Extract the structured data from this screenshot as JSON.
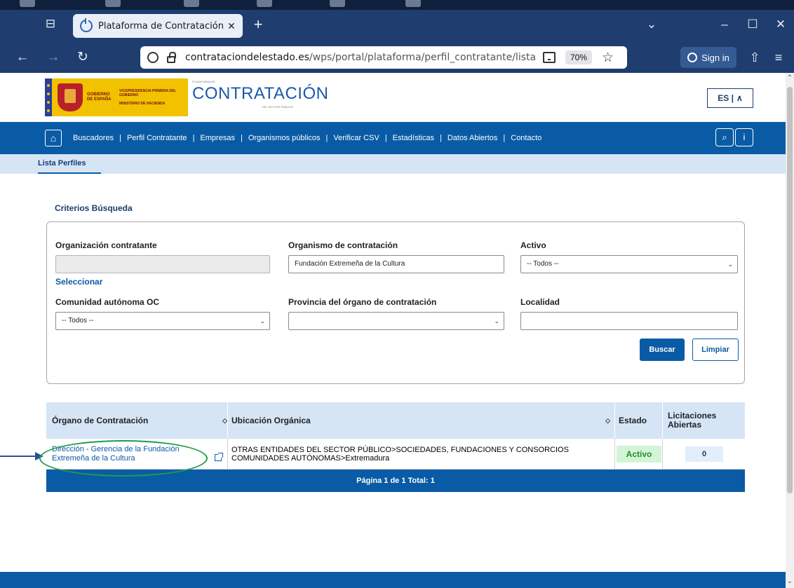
{
  "browser": {
    "tab_title": "Plataforma de Contratación del",
    "tab_close": "✕",
    "new_tab": "+",
    "url_domain": "contrataciondelestado.es",
    "url_path": "/wps/portal/plataforma/perfil_contratante/lista_perfi",
    "zoom": "70%",
    "sign_in": "Sign in",
    "window_controls": [
      "⌄",
      "–",
      "☐",
      "✕"
    ]
  },
  "header": {
    "gov_text": "GOBIERNO DE ESPAÑA",
    "vice_text": "VICEPRESIDENCIA PRIMERA DEL GOBIERNO",
    "ministry_text": "MINISTERIO DE HACIENDA",
    "brand_small": "PLATAFORMA DE",
    "brand_word": "CONTRATACIÓN",
    "brand_sub": "DEL SECTOR PÚBLICO",
    "language": "ES |"
  },
  "nav": {
    "items": [
      "Buscadores",
      "Perfil Contratante",
      "Empresas",
      "Organismos públicos",
      "Verificar CSV",
      "Estadísticas",
      "Datos Abiertos",
      "Contacto"
    ]
  },
  "subnav": {
    "active": "Lista Perfiles"
  },
  "search": {
    "title": "Criterios Búsqueda",
    "org_contratante_label": "Organización contratante",
    "org_contratante_value": "",
    "select_link": "Seleccionar",
    "organismo_label": "Organismo de contratación",
    "organismo_value": "Fundación Extremeña de la Cultura",
    "activo_label": "Activo",
    "activo_value": "-- Todos --",
    "comunidad_label": "Comunidad autónoma OC",
    "comunidad_value": "-- Todos --",
    "provincia_label": "Provincia del órgano de contratación",
    "provincia_value": "",
    "localidad_label": "Localidad",
    "localidad_value": "",
    "buscar_label": "Buscar",
    "limpiar_label": "Limpiar"
  },
  "results": {
    "columns": [
      "Órgano de Contratación",
      "Ubicación Orgánica",
      "Estado",
      "Licitaciones Abiertas"
    ],
    "rows": [
      {
        "organo": "Dirección - Gerencia de la Fundación Extremeña de la Cultura",
        "ubicacion_line1": "OTRAS ENTIDADES DEL SECTOR PÚBLICO>SOCIEDADES, FUNDACIONES Y CONSORCIOS",
        "ubicacion_line2": "COMUNIDADES AUTÓNOMAS>Extremadura",
        "estado": "Activo",
        "licitaciones": "0"
      }
    ],
    "pager": "Página  1  de  1  Total:  1"
  },
  "colors": {
    "brand_blue": "#0a5ba6",
    "subnav_blue": "#d5e5f6",
    "annotation_green": "#1e9b4b",
    "annotation_arrow": "#2b4f9c"
  }
}
